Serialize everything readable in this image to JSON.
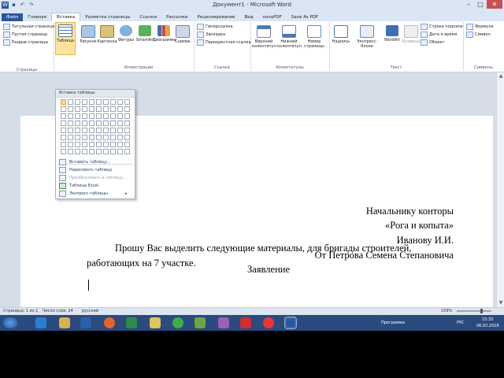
{
  "window": {
    "title": "Документ1 - Microsoft Word"
  },
  "tabs": [
    "Файл",
    "Главная",
    "Вставка",
    "Разметка страницы",
    "Ссылки",
    "Рассылки",
    "Рецензирование",
    "Вид",
    "novaPDF",
    "Save As PDF"
  ],
  "ribbon": {
    "pages": {
      "items": [
        "Титульная страница",
        "Пустая страница",
        "Разрыв страницы"
      ],
      "label": "Страницы"
    },
    "tables": {
      "button": "Таблица"
    },
    "illustrations": {
      "buttons": [
        "Рисунок",
        "Картинка",
        "Фигуры",
        "SmartArt",
        "Диаграмма",
        "Снимок"
      ],
      "label": "Иллюстрации"
    },
    "links": {
      "items": [
        "Гиперссылка",
        "Закладка",
        "Перекрестная ссылка"
      ],
      "label": "Ссылки"
    },
    "headers": {
      "buttons": [
        "Верхний колонтитул",
        "Нижний колонтитул",
        "Номер страницы"
      ],
      "label": "Колонтитулы"
    },
    "text": {
      "buttons": [
        "Надпись",
        "Экспресс-блоки",
        "WordArt",
        "Буквица"
      ],
      "items": [
        "Строка подписи",
        "Дата и время",
        "Объект"
      ],
      "label": "Текст"
    },
    "symbols": {
      "items": [
        "Формула",
        "Символ"
      ],
      "label": "Символы"
    }
  },
  "table_menu": {
    "header": "Вставка таблицы",
    "items": [
      {
        "label": "Вставить таблицу...",
        "enabled": true
      },
      {
        "label": "Нарисовать таблицу",
        "enabled": true
      },
      {
        "label": "Преобразовать в таблицу...",
        "enabled": false
      },
      {
        "label": "Таблица Excel",
        "enabled": true
      },
      {
        "label": "Экспресс-таблицы",
        "enabled": true
      }
    ]
  },
  "document": {
    "recipient1": "Начальнику конторы",
    "recipient2": "«Рога и копыта»",
    "recipient3": "Иванову И.И.",
    "sender": "От Петрова Семена Степановича",
    "heading": "Заявление",
    "body_line1": "Прошу Вас выделить следующие материалы, для бригады строителей,",
    "body_line2": "работающих на 7 участке."
  },
  "status": {
    "page": "Страница: 1 из 1",
    "words": "Число слов: 24",
    "lang": "русский",
    "zoom": "159%"
  },
  "tray": {
    "programs": "Программы",
    "lang": "РУС",
    "time": "15:35",
    "date": "06.02.2018"
  },
  "colors": {
    "word_blue": "#2b579a",
    "highlight": "#fce49c"
  }
}
